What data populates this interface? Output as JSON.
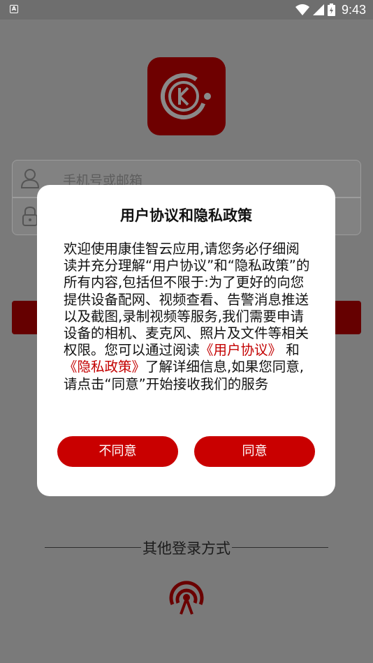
{
  "status_bar": {
    "time": "9:43",
    "icons": [
      "app-notification-icon",
      "wifi-icon",
      "signal-icon",
      "battery-icon"
    ],
    "app_badge": "A"
  },
  "login": {
    "account_placeholder": "手机号或邮箱",
    "other_login_label": "其他登录方式"
  },
  "dialog": {
    "title": "用户协议和隐私政策",
    "body_intro": "欢迎使用康佳智云应用,请您务必仔细阅读并充分理解“用户协议”和“隐私政策”的所有内容,包括但不限于:为了更好的向您提供设备配网、视频查看、告警消息推送以及截图,录制视频等服务,我们需要申请设备的相机、麦克风、照片及文件等相关权限。您可以通过阅读",
    "user_agreement_link": "《用户协议》",
    "and_text": " 和 ",
    "privacy_link": "《隐私政策》",
    "body_outro": "了解详细信息,如果您同意,请点击“同意”开始接收我们的服务",
    "disagree_label": "不同意",
    "agree_label": "同意"
  },
  "colors": {
    "accent": "#c90000",
    "overlay": "#7a7a7a",
    "dialog_bg": "#ffffff"
  }
}
